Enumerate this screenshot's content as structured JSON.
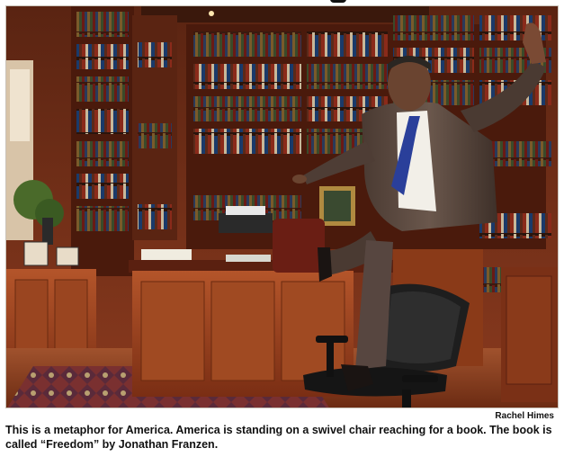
{
  "photo": {
    "subject": "man-on-swivel-chair-in-library"
  },
  "credit": "Rachel Himes",
  "caption": "This is a metaphor for America. America is standing on a swivel chair reaching for a book. The book is called “Freedom” by Jonathan Franzen.",
  "colors": {
    "wood": "#8a3a1e",
    "wood_dark": "#4a1a0c",
    "suit": "#5c4a40",
    "tie": "#2a3f9a",
    "chair": "#1e1e1e",
    "rug": "#7a3030"
  }
}
